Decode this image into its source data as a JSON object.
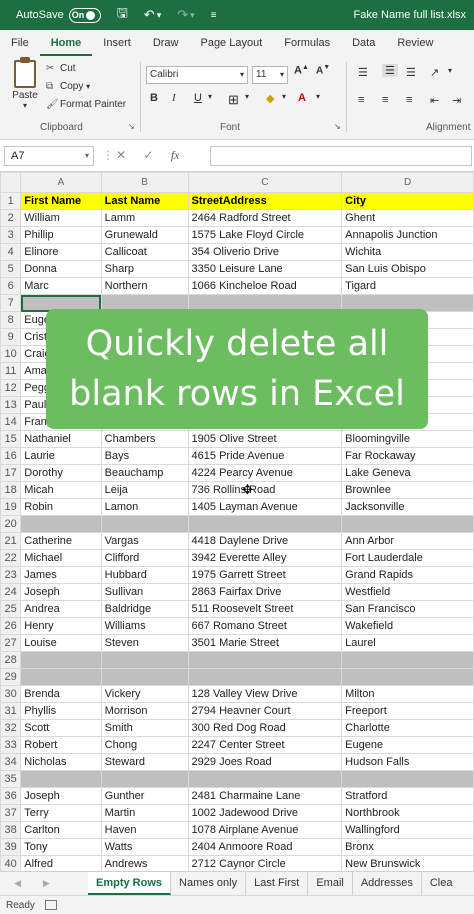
{
  "titlebar": {
    "autosave_label": "AutoSave",
    "autosave_state": "On",
    "file_name": "Fake Name full list.xlsx"
  },
  "menu": [
    "File",
    "Home",
    "Insert",
    "Draw",
    "Page Layout",
    "Formulas",
    "Data",
    "Review"
  ],
  "ribbon": {
    "paste_label": "Paste",
    "cut_label": "Cut",
    "copy_label": "Copy",
    "format_painter_label": "Format Painter",
    "clipboard_group": "Clipboard",
    "font_name": "Calibri",
    "font_size": "11",
    "font_group": "Font",
    "alignment_group": "Alignment"
  },
  "formula_bar": {
    "name_box": "A7",
    "cancel_symbol": "✕",
    "enter_symbol": "✓",
    "fx_label": "fx",
    "formula": ""
  },
  "columns": [
    "A",
    "B",
    "C",
    "D"
  ],
  "headers": [
    "First Name",
    "Last Name",
    "StreetAddress",
    "City"
  ],
  "rows": [
    {
      "n": "1",
      "cells": [
        "First Name",
        "Last Name",
        "StreetAddress",
        "City"
      ],
      "type": "hdr"
    },
    {
      "n": "2",
      "cells": [
        "William",
        "Lamm",
        "2464 Radford Street",
        "Ghent"
      ]
    },
    {
      "n": "3",
      "cells": [
        "Phillip",
        "Grunewald",
        "1575 Lake Floyd Circle",
        "Annapolis Junction"
      ]
    },
    {
      "n": "4",
      "cells": [
        "Elinore",
        "Callicoat",
        "354 Oliverio Drive",
        "Wichita"
      ]
    },
    {
      "n": "5",
      "cells": [
        "Donna",
        "Sharp",
        "3350 Leisure Lane",
        "San Luis Obispo"
      ]
    },
    {
      "n": "6",
      "cells": [
        "Marc",
        "Northern",
        "1066 Kincheloe Road",
        "Tigard"
      ]
    },
    {
      "n": "7",
      "cells": [
        "",
        "",
        "",
        ""
      ],
      "type": "blank"
    },
    {
      "n": "8",
      "cells": [
        "Euge",
        "",
        "",
        ""
      ]
    },
    {
      "n": "9",
      "cells": [
        "Crist",
        "",
        "",
        ""
      ]
    },
    {
      "n": "10",
      "cells": [
        "Craig",
        "",
        "",
        ""
      ]
    },
    {
      "n": "11",
      "cells": [
        "Ama",
        "",
        "",
        ""
      ]
    },
    {
      "n": "12",
      "cells": [
        "Pegg",
        "",
        "",
        ""
      ]
    },
    {
      "n": "13",
      "cells": [
        "Paul",
        "",
        "",
        ""
      ]
    },
    {
      "n": "14",
      "cells": [
        "Fran",
        "",
        "",
        ""
      ]
    },
    {
      "n": "15",
      "cells": [
        "Nathaniel",
        "Chambers",
        "1905 Olive Street",
        "Bloomingville"
      ]
    },
    {
      "n": "16",
      "cells": [
        "Laurie",
        "Bays",
        "4615 Pride Avenue",
        "Far Rockaway"
      ]
    },
    {
      "n": "17",
      "cells": [
        "Dorothy",
        "Beauchamp",
        "4224 Pearcy Avenue",
        "Lake Geneva"
      ]
    },
    {
      "n": "18",
      "cells": [
        "Micah",
        "Leija",
        "736 Rollins Road",
        "Brownlee"
      ]
    },
    {
      "n": "19",
      "cells": [
        "Robin",
        "Lamon",
        "1405 Layman Avenue",
        "Jacksonville"
      ]
    },
    {
      "n": "20",
      "cells": [
        "",
        "",
        "",
        ""
      ],
      "type": "blank"
    },
    {
      "n": "21",
      "cells": [
        "Catherine",
        "Vargas",
        "4418 Daylene Drive",
        "Ann Arbor"
      ]
    },
    {
      "n": "22",
      "cells": [
        "Michael",
        "Clifford",
        "3942 Everette Alley",
        "Fort Lauderdale"
      ]
    },
    {
      "n": "23",
      "cells": [
        "James",
        "Hubbard",
        "1975 Garrett Street",
        "Grand Rapids"
      ]
    },
    {
      "n": "24",
      "cells": [
        "Joseph",
        "Sullivan",
        "2863 Fairfax Drive",
        "Westfield"
      ]
    },
    {
      "n": "25",
      "cells": [
        "Andrea",
        "Baldridge",
        "511 Roosevelt Street",
        "San Francisco"
      ]
    },
    {
      "n": "26",
      "cells": [
        "Henry",
        "Williams",
        "667 Romano Street",
        "Wakefield"
      ]
    },
    {
      "n": "27",
      "cells": [
        "Louise",
        "Steven",
        "3501 Marie Street",
        "Laurel"
      ]
    },
    {
      "n": "28",
      "cells": [
        "",
        "",
        "",
        ""
      ],
      "type": "blank"
    },
    {
      "n": "29",
      "cells": [
        "",
        "",
        "",
        ""
      ],
      "type": "blank"
    },
    {
      "n": "30",
      "cells": [
        "Brenda",
        "Vickery",
        "128 Valley View Drive",
        "Milton"
      ]
    },
    {
      "n": "31",
      "cells": [
        "Phyllis",
        "Morrison",
        "2794 Heavner Court",
        "Freeport"
      ]
    },
    {
      "n": "32",
      "cells": [
        "Scott",
        "Smith",
        "300 Red Dog Road",
        "Charlotte"
      ]
    },
    {
      "n": "33",
      "cells": [
        "Robert",
        "Chong",
        "2247 Center Street",
        "Eugene"
      ]
    },
    {
      "n": "34",
      "cells": [
        "Nicholas",
        "Steward",
        "2929 Joes Road",
        "Hudson Falls"
      ]
    },
    {
      "n": "35",
      "cells": [
        "",
        "",
        "",
        ""
      ],
      "type": "blank"
    },
    {
      "n": "36",
      "cells": [
        "Joseph",
        "Gunther",
        "2481 Charmaine Lane",
        "Stratford"
      ]
    },
    {
      "n": "37",
      "cells": [
        "Terry",
        "Martin",
        "1002 Jadewood Drive",
        "Northbrook"
      ]
    },
    {
      "n": "38",
      "cells": [
        "Carlton",
        "Haven",
        "1078 Airplane Avenue",
        "Wallingford"
      ]
    },
    {
      "n": "39",
      "cells": [
        "Tony",
        "Watts",
        "2404 Anmoore Road",
        "Bronx"
      ]
    },
    {
      "n": "40",
      "cells": [
        "Alfred",
        "Andrews",
        "2712 Caynor Circle",
        "New Brunswick"
      ]
    }
  ],
  "overlay": {
    "line1": "Quickly delete all",
    "line2": "blank rows in Excel"
  },
  "sheet_tabs": [
    "Empty Rows",
    "Names only",
    "Last First",
    "Email",
    "Addresses",
    "Clea"
  ],
  "active_sheet": "Empty Rows",
  "status": {
    "mode": "Ready"
  },
  "colors": {
    "excel_green": "#1d6f42",
    "header_fill": "#ffff00",
    "blank_row_fill": "#bfbfbf",
    "overlay_fill": "#6bbd60"
  }
}
